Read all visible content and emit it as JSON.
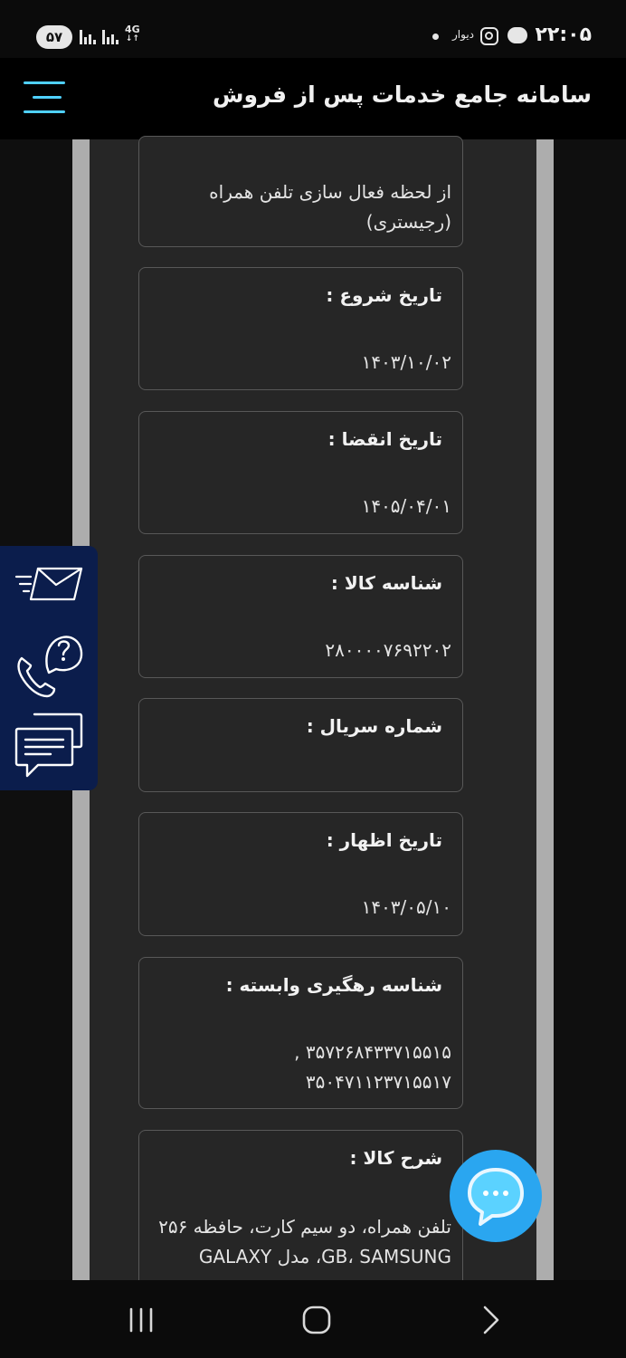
{
  "status_bar": {
    "time": "۲۲:۰۵",
    "battery": "۵۷",
    "network": "4G",
    "notification_app_label": "دیوار"
  },
  "header": {
    "title": "سامانه جامع خدمات پس از فروش",
    "menu_icon": "hamburger-menu-icon"
  },
  "fields": {
    "warranty_start": {
      "value_line1": "از لحظه فعال سازی تلفن همراه",
      "value_line2": "(رجیستری)"
    },
    "start_date": {
      "label": "تاریخ شروع :",
      "value": "۱۴۰۳/۱۰/۰۲"
    },
    "expiry_date": {
      "label": "تاریخ انقضا :",
      "value": "۱۴۰۵/۰۴/۰۱"
    },
    "product_id": {
      "label": "شناسه کالا :",
      "value": "۲۸۰۰۰۰۷۶۹۲۲۰۲"
    },
    "serial_number": {
      "label": "شماره سریال :",
      "value": ""
    },
    "declaration_date": {
      "label": "تاریخ اظهار :",
      "value": "۱۴۰۳/۰۵/۱۰"
    },
    "tracking_ids": {
      "label": "شناسه رهگیری وابسته :",
      "value_line1": "۳۵۷۲۶۸۴۳۳۷۱۵۵۱۵ ,",
      "value_line2": "۳۵۰۴۷۱۱۲۳۷۱۵۵۱۷"
    },
    "description": {
      "label": "شرح کالا :",
      "value_line1": "تلفن همراه، دو سیم کارت، حافظه ۲۵۶",
      "value_line2": "GB، SAMSUNG، مدل GALAXY"
    }
  },
  "side_panel": {
    "icons": [
      "mail-icon",
      "phone-support-icon",
      "chat-messages-icon"
    ]
  },
  "chat_button": {
    "icon": "chat-bubble-icon"
  },
  "nav_bar": {
    "icons": [
      "recent-apps-icon",
      "home-icon",
      "back-icon"
    ]
  },
  "colors": {
    "accent": "#4fd0ff",
    "panel": "#0b1d4c",
    "fab": "#2aa6f0",
    "card_bg": "#262626"
  }
}
